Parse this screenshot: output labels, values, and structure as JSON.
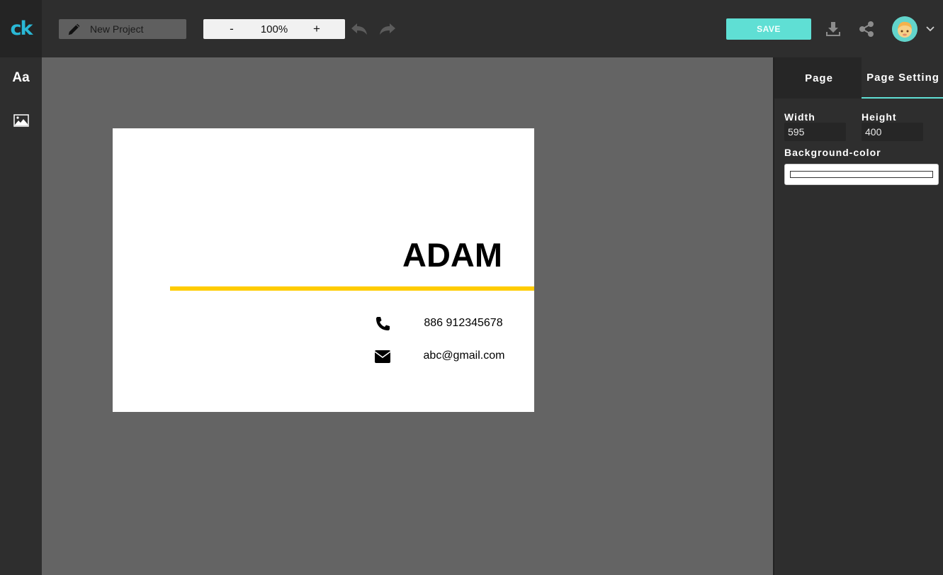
{
  "app": {
    "logo": "ck",
    "project_name": "New Project",
    "zoom": "100%",
    "zoom_minus": "-",
    "zoom_plus": "+",
    "save_label": "SAVE"
  },
  "left_toolbar": {
    "text_tool": "Aa"
  },
  "card": {
    "name": "ADAM",
    "phone": "886 912345678",
    "email": "abc@gmail.com",
    "accent_color": "#ffcc00"
  },
  "panel": {
    "tabs": [
      "Page",
      "Page Setting"
    ],
    "active_tab": "Page Setting",
    "width_label": "Width",
    "height_label": "Height",
    "width_value": "595",
    "height_value": "400",
    "bg_label": "Background-color",
    "bg_value": "#ffffff"
  },
  "colors": {
    "accent": "#5fdfd4",
    "logo": "#2ab8d6"
  }
}
